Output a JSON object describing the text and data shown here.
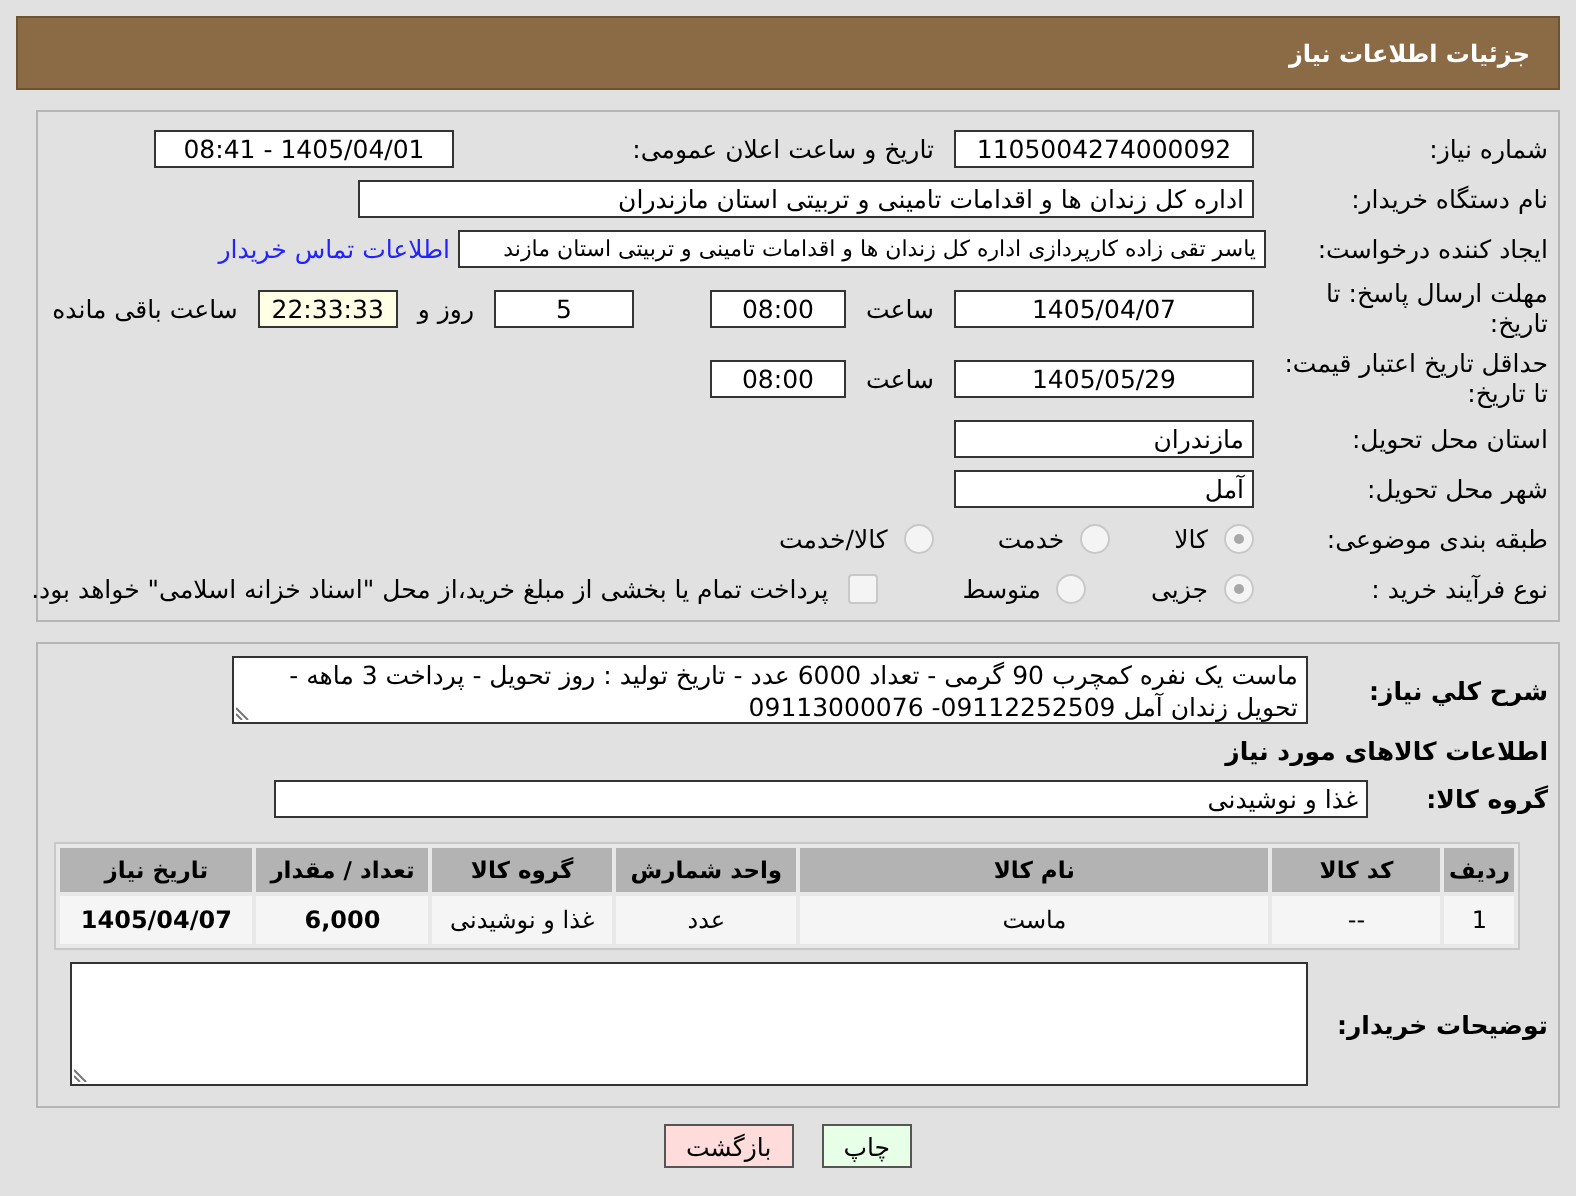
{
  "title": "جزئیات اطلاعات نیاز",
  "need_number": {
    "label": "شماره نیاز:",
    "value": "1105004274000092"
  },
  "announce": {
    "label": "تاریخ و ساعت اعلان عمومی:",
    "value": "1405/04/01 - 08:41"
  },
  "buyer_org": {
    "label": "نام دستگاه خریدار:",
    "value": "اداره کل زندان ها و اقدامات تامینی و تربیتی استان مازندران"
  },
  "requester": {
    "label": "ایجاد کننده درخواست:",
    "value": "یاسر تقی زاده کارپردازی اداره کل زندان ها و اقدامات تامینی و تربیتی استان مازند",
    "link": "اطلاعات تماس خریدار"
  },
  "response_deadline": {
    "label": "مهلت ارسال پاسخ: تا تاریخ:",
    "date": "1405/04/07",
    "time_label": "ساعت",
    "time": "08:00",
    "days": "5",
    "days_label": "روز و",
    "remaining": "22:33:33",
    "remaining_label": "ساعت باقی مانده"
  },
  "price_validity": {
    "label": "حداقل تاریخ اعتبار قیمت: تا تاریخ:",
    "date": "1405/05/29",
    "time_label": "ساعت",
    "time": "08:00"
  },
  "province": {
    "label": "استان محل تحویل:",
    "value": "مازندران"
  },
  "city": {
    "label": "شهر محل تحویل:",
    "value": "آمل"
  },
  "category": {
    "label": "طبقه بندی موضوعی:",
    "options": [
      {
        "label": "کالا",
        "selected": true
      },
      {
        "label": "خدمت",
        "selected": false
      },
      {
        "label": "کالا/خدمت",
        "selected": false
      }
    ]
  },
  "process": {
    "label": "نوع فرآیند خرید :",
    "options": [
      {
        "label": "جزیی",
        "selected": true
      },
      {
        "label": "متوسط",
        "selected": false
      }
    ],
    "payment": {
      "checked": false,
      "text": "پرداخت تمام یا بخشی از مبلغ خرید،از محل \"اسناد خزانه اسلامی\" خواهد بود."
    }
  },
  "description": {
    "label": "شرح كلي نياز:",
    "value": "ماست یک نفره کمچرب 90 گرمی - تعداد 6000 عدد -  تاریخ تولید : روز تحویل - پرداخت 3 ماهه - تحویل زندان آمل  09112252509- 09113000076"
  },
  "goods_heading": "اطلاعات کالاهای مورد نیاز",
  "goods_group": {
    "label": "گروه کالا:",
    "value": "غذا و نوشیدنی"
  },
  "table": {
    "columns": [
      "ردیف",
      "کد کالا",
      "نام کالا",
      "واحد شمارش",
      "گروه کالا",
      "تعداد / مقدار",
      "تاریخ نیاز"
    ],
    "rows": [
      [
        "1",
        "--",
        "ماست",
        "عدد",
        "غذا و نوشیدنی",
        "6,000",
        "1405/04/07"
      ]
    ]
  },
  "buyer_notes": {
    "label": "توضیحات خریدار:"
  },
  "buttons": [
    {
      "label": "چاپ",
      "kind": "print"
    },
    {
      "label": "بازگشت",
      "kind": "back"
    }
  ]
}
